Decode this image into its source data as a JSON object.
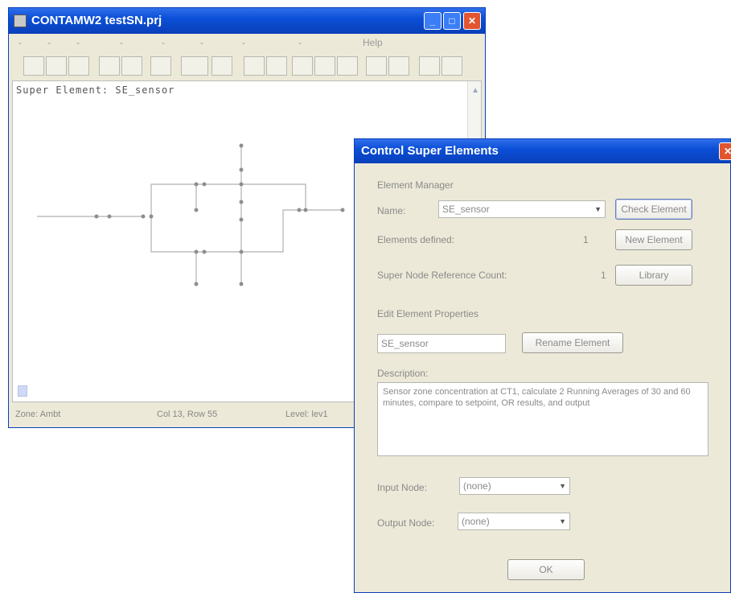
{
  "main_window": {
    "title": "CONTAMW2  testSN.prj",
    "buttons": {
      "minimize": "_",
      "maximize": "□",
      "close": "✕"
    },
    "menu": [
      "-",
      "-",
      "-",
      "-",
      "-",
      "-",
      "-",
      "-",
      "Help"
    ],
    "toolbar": [
      "",
      "",
      "",
      "",
      "",
      "",
      "",
      "",
      "",
      "",
      "",
      "",
      "",
      "",
      "",
      "",
      ""
    ],
    "editor_header": "Super Element: SE_sensor",
    "status": {
      "zone": "Zone: Ambt",
      "cell": "Col 13, Row 55",
      "level": "Level: lev1"
    }
  },
  "dialog": {
    "title": "Control Super Elements",
    "close": "✕",
    "element_manager": {
      "heading": "Element Manager",
      "name_label": "Name:",
      "name_value": "SE_sensor",
      "check_button": "Check Element",
      "defined_label": "Elements defined:",
      "defined_value": "1",
      "new_button": "New Element",
      "refcount_label": "Super Node Reference Count:",
      "refcount_value": "1",
      "library_button": "Library"
    },
    "edit_properties": {
      "heading": "Edit Element Properties",
      "name_value": "SE_sensor",
      "rename_button": "Rename Element",
      "description_label": "Description:",
      "description_text": "Sensor zone concentration at CT1, calculate 2 Running Averages of 30 and 60 minutes, compare to setpoint, OR results, and output",
      "input_label": "Input Node:",
      "input_value": "(none)",
      "output_label": "Output Node:",
      "output_value": "(none)",
      "ok_button": "OK"
    }
  },
  "colors": {
    "titlebar": "#0b4fd8",
    "window": "#ece9d8",
    "close": "#e2552f"
  }
}
